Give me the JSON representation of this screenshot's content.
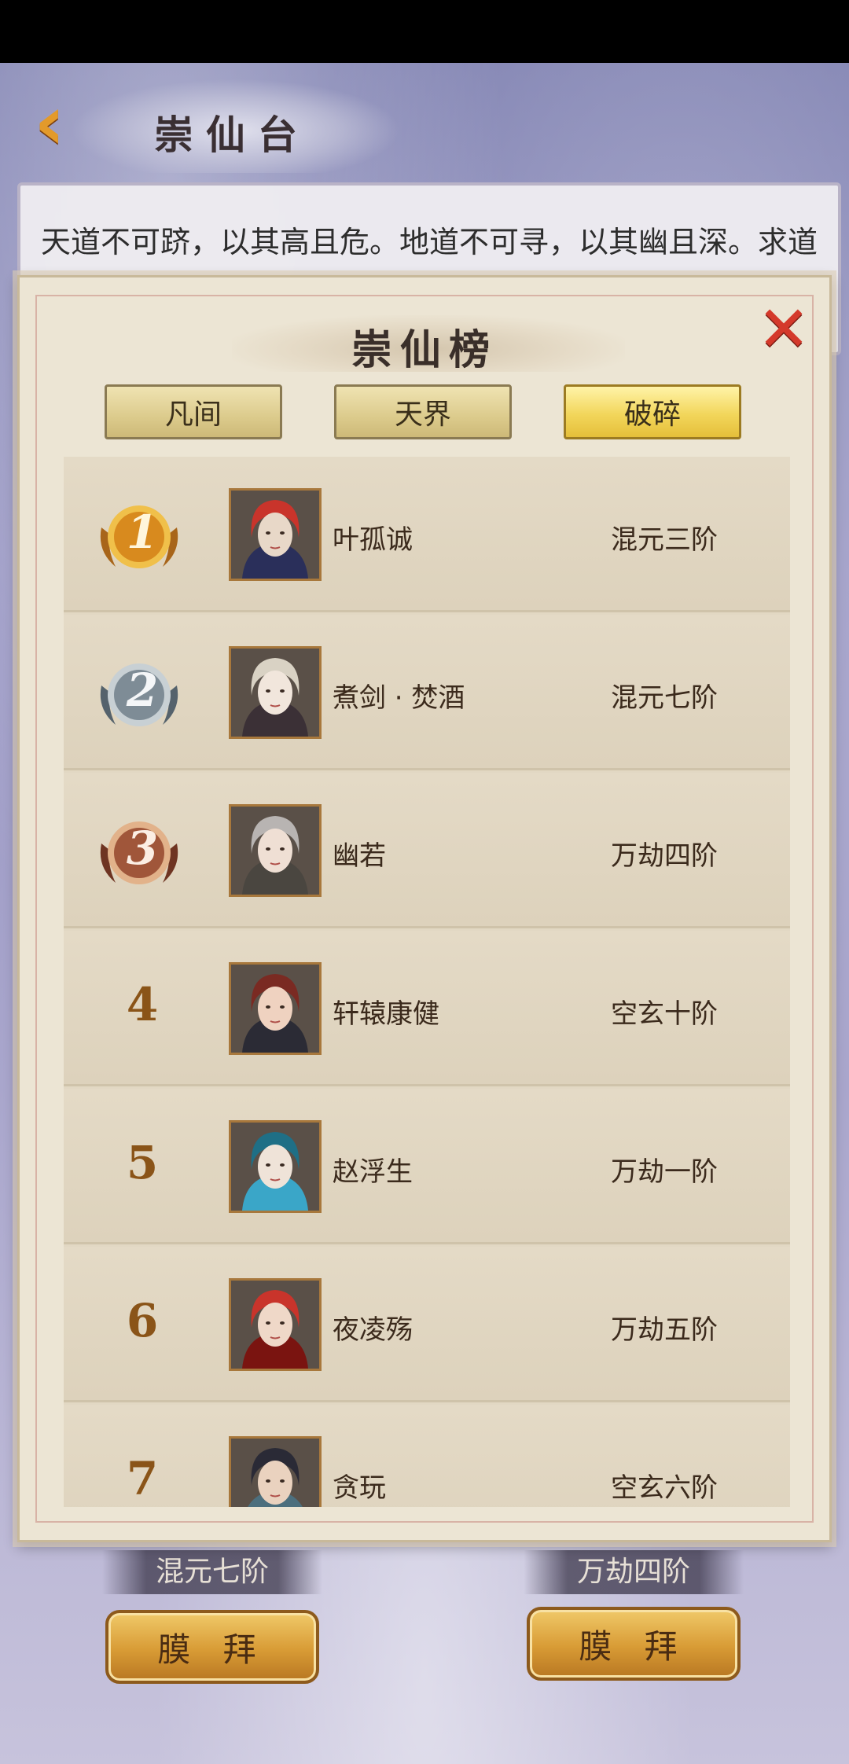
{
  "header": {
    "back_icon": "chevron-left-icon",
    "title": "崇仙台"
  },
  "intro": {
    "text": "天道不可跻，以其高且危。地道不可寻，以其幽且深。求道者无数，如恒河沙之，惟拔螺旋，探索冥…"
  },
  "modal": {
    "title": "崇仙榜",
    "close_icon": "close-icon",
    "tabs": [
      {
        "label": "凡间",
        "active": false
      },
      {
        "label": "天界",
        "active": false
      },
      {
        "label": "破碎",
        "active": true
      }
    ],
    "rows": [
      {
        "rank": "1",
        "medal": "gold",
        "name": "叶孤诚",
        "realm": "混元三阶",
        "avatar_colors": [
          "#c9342b",
          "#e8d8c8",
          "#2a2f5a"
        ]
      },
      {
        "rank": "2",
        "medal": "silver",
        "name": "煮剑 · 焚酒",
        "realm": "混元七阶",
        "avatar_colors": [
          "#d9d2c4",
          "#f1e6dc",
          "#3b3036"
        ]
      },
      {
        "rank": "3",
        "medal": "bronze",
        "name": "幽若",
        "realm": "万劫四阶",
        "avatar_colors": [
          "#b8b4b2",
          "#efdfd4",
          "#4a4640"
        ]
      },
      {
        "rank": "4",
        "medal": "",
        "name": "轩辕康健",
        "realm": "空玄十阶",
        "avatar_colors": [
          "#7a2a22",
          "#efd2c0",
          "#2b2b35"
        ]
      },
      {
        "rank": "5",
        "medal": "",
        "name": "赵浮生",
        "realm": "万劫一阶",
        "avatar_colors": [
          "#1f6f86",
          "#efe3d8",
          "#3aa6c8"
        ]
      },
      {
        "rank": "6",
        "medal": "",
        "name": "夜凌殇",
        "realm": "万劫五阶",
        "avatar_colors": [
          "#c9342b",
          "#efd8c8",
          "#7a1410"
        ]
      },
      {
        "rank": "7",
        "medal": "",
        "name": "贪玩",
        "realm": "空玄六阶",
        "avatar_colors": [
          "#2a2a36",
          "#ead2bf",
          "#4c6f7e"
        ]
      }
    ]
  },
  "background_cards": [
    {
      "realm": "混元七阶",
      "button": "膜 拜"
    },
    {
      "realm": "万劫四阶",
      "button": "膜 拜"
    }
  ]
}
